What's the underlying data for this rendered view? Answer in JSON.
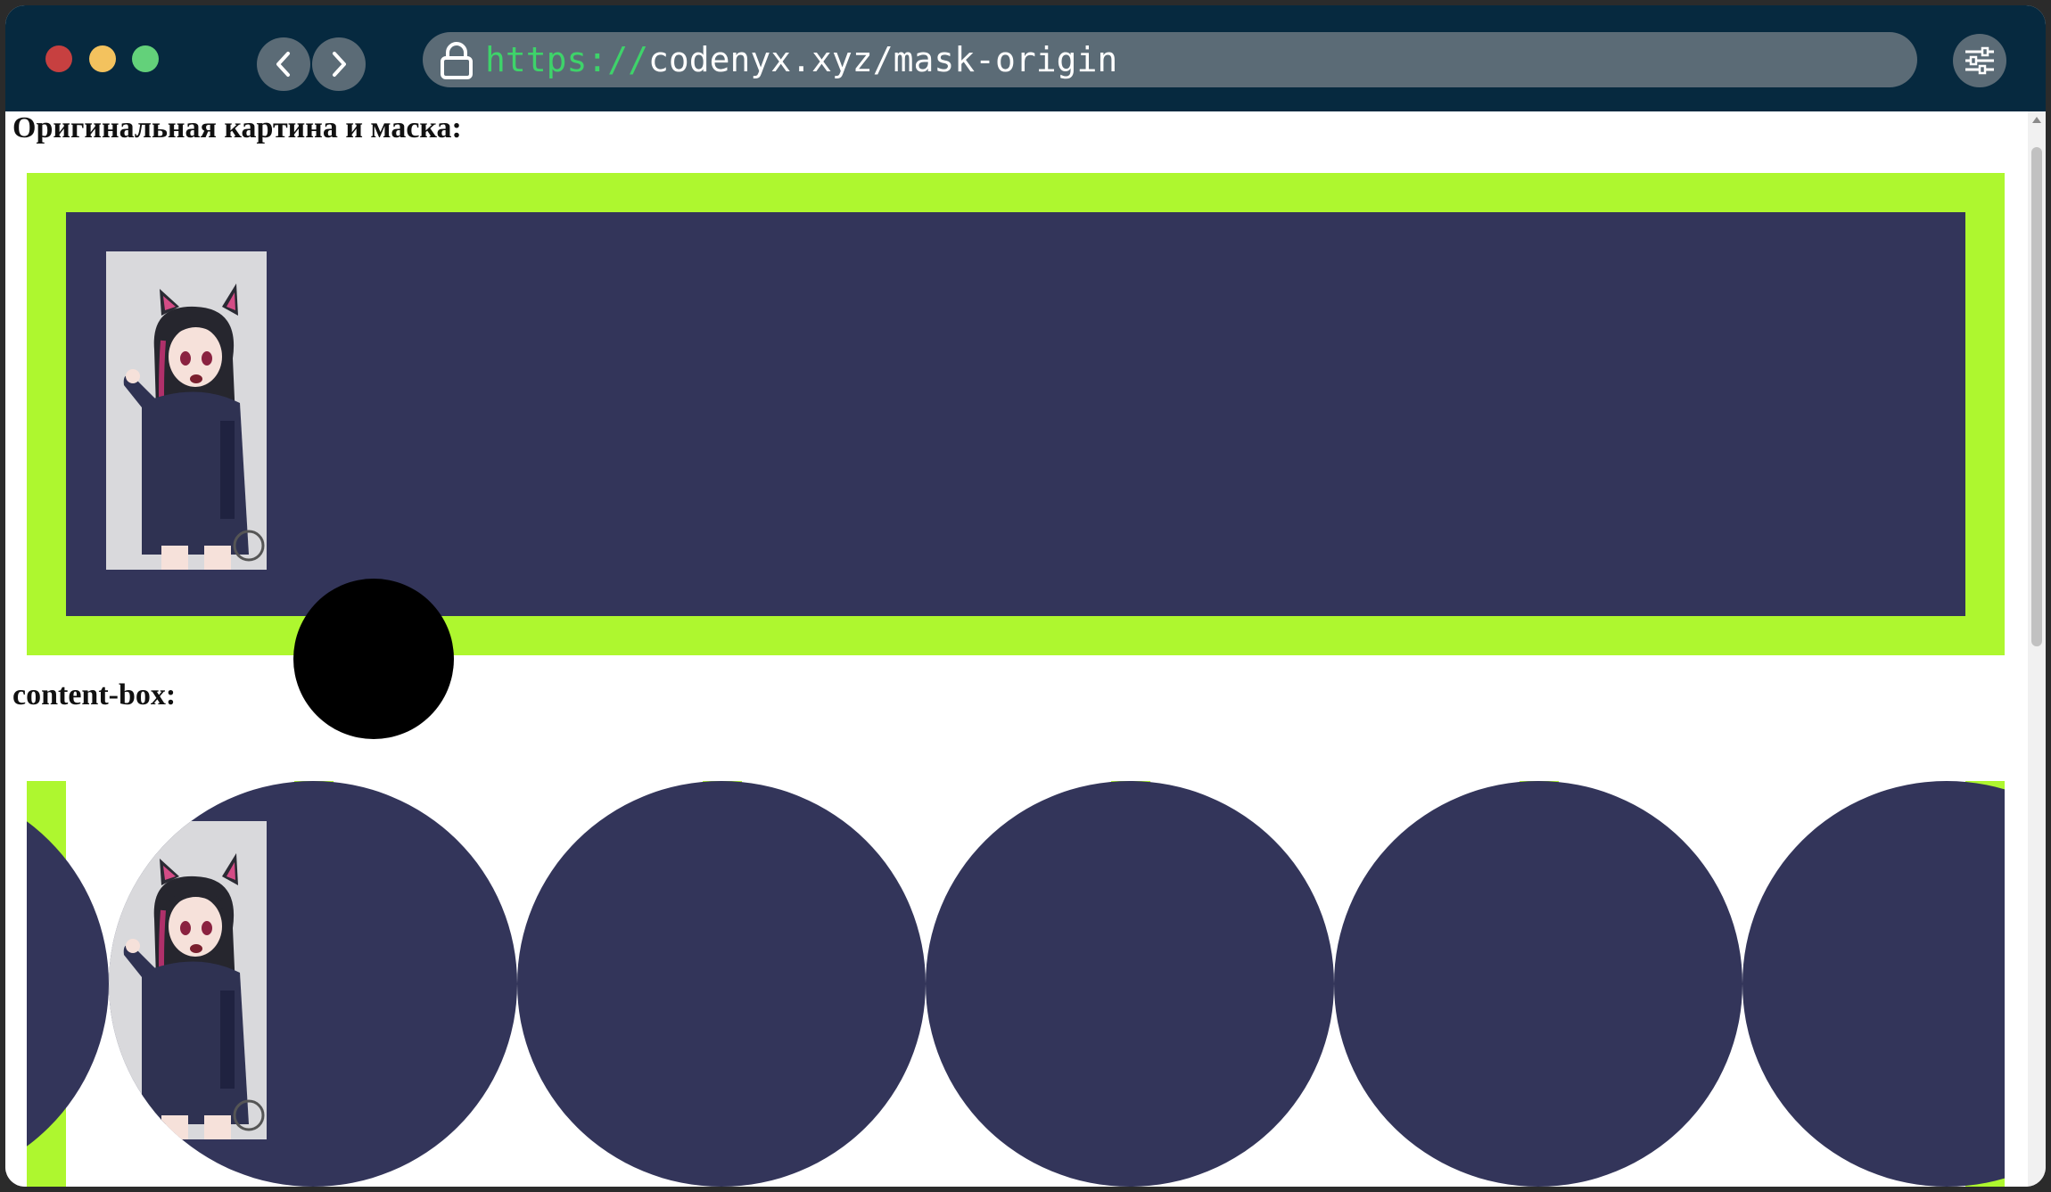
{
  "browser": {
    "url_scheme": "https://",
    "url_rest": "codenyx.xyz/mask-origin",
    "back_icon": "chevron-left-icon",
    "forward_icon": "chevron-right-icon",
    "lock_icon": "lock-icon",
    "menu_icon": "sliders-icon"
  },
  "page": {
    "heading_original": "Оригинальная картина и маска:",
    "heading_content_box": "content-box:"
  },
  "colors": {
    "titlebar": "#06293f",
    "url_scheme": "#3ed36a",
    "border_green": "#aef72f",
    "box_navy": "#33355a",
    "mask_black": "#000000"
  }
}
